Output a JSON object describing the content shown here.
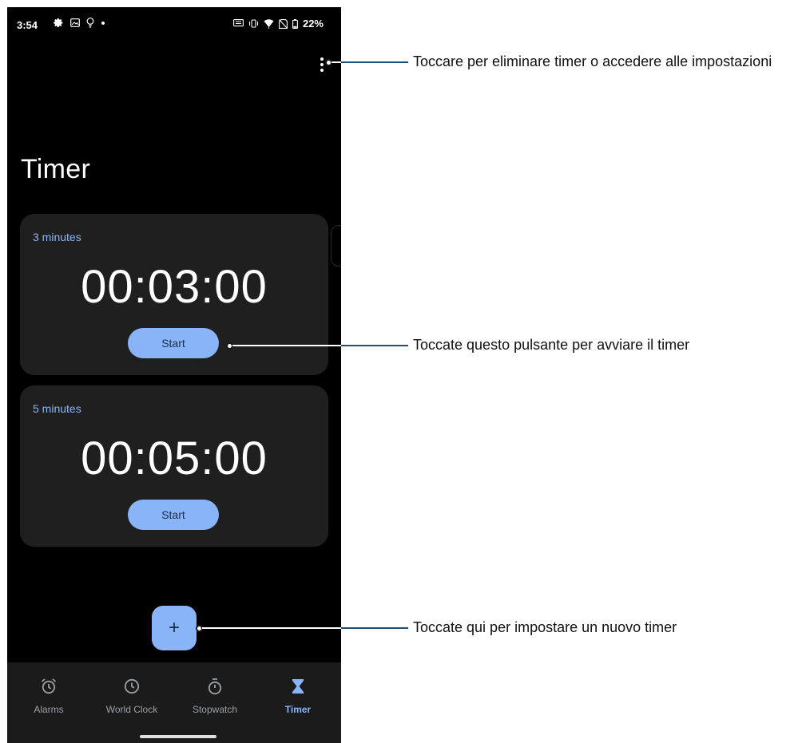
{
  "status_bar": {
    "time": "3:54",
    "left_icons": [
      "gear-icon",
      "image-icon",
      "lightbulb-icon",
      "dot-icon"
    ],
    "right_icons": [
      "keyboard-icon",
      "vibrate-icon",
      "wifi-icon",
      "no-sim-icon",
      "battery-icon"
    ],
    "battery_text": "22%"
  },
  "page": {
    "title": "Timer",
    "overflow_icon": "more-vert-icon"
  },
  "timers": [
    {
      "label": "3 minutes",
      "time": "00:03:00",
      "start_label": "Start"
    },
    {
      "label": "5 minutes",
      "time": "00:05:00",
      "start_label": "Start"
    }
  ],
  "fab": {
    "icon": "plus-icon",
    "symbol": "+"
  },
  "bottom_nav": [
    {
      "label": "Alarms",
      "icon": "alarm-icon",
      "active": false
    },
    {
      "label": "World Clock",
      "icon": "clock-icon",
      "active": false
    },
    {
      "label": "Stopwatch",
      "icon": "stopwatch-icon",
      "active": false
    },
    {
      "label": "Timer",
      "icon": "hourglass-icon",
      "active": true
    }
  ],
  "annotations": {
    "menu": "Toccare per eliminare timer o accedere alle impostazioni",
    "start": "Toccate questo pulsante per avviare il timer",
    "add": "Toccate qui per impostare un nuovo timer"
  },
  "colors": {
    "accent": "#8ab4f8",
    "background": "#000000",
    "card": "#1f1f1f",
    "nav_background": "#1b1b1b",
    "callout_line": "#1f4e79"
  }
}
